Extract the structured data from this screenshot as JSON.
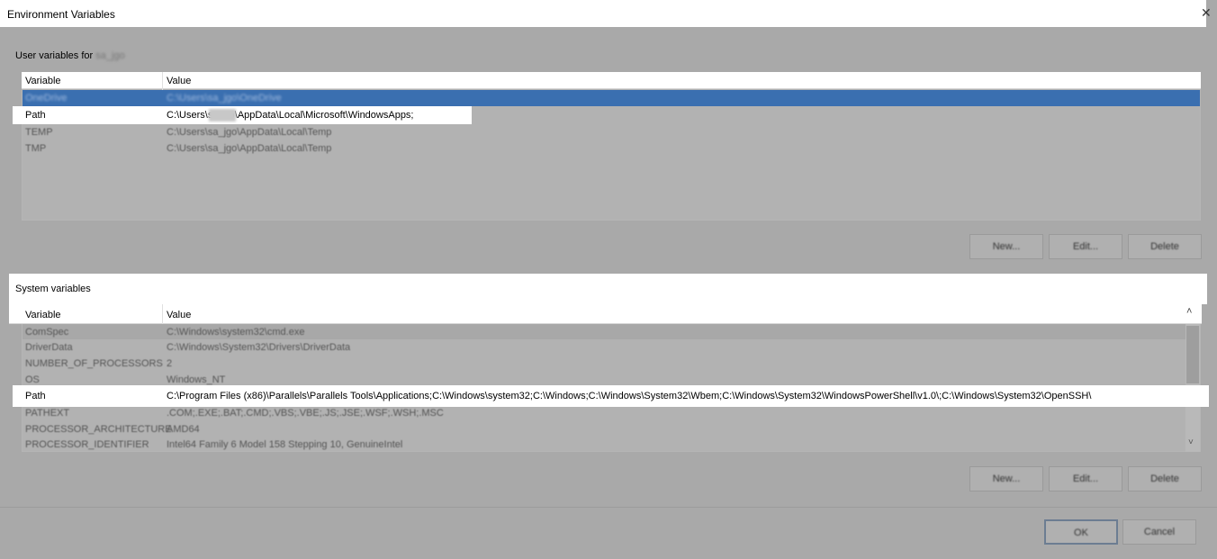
{
  "window": {
    "title": "Environment Variables",
    "close_glyph": "✕"
  },
  "user_vars": {
    "group_label": "User variables for",
    "user_name": "sa_jgo",
    "columns": [
      "Variable",
      "Value"
    ],
    "rows": [
      {
        "name": "OneDrive",
        "value": "C:\\Users\\sa_jgo\\OneDrive"
      },
      {
        "name": "Path",
        "value": "C:\\Users\\s      o\\AppData\\Local\\Microsoft\\WindowsApps;"
      },
      {
        "name": "TEMP",
        "value": "C:\\Users\\sa_jgo\\AppData\\Local\\Temp"
      },
      {
        "name": "TMP",
        "value": "C:\\Users\\sa_jgo\\AppData\\Local\\Temp"
      }
    ],
    "buttons": {
      "new": "New...",
      "edit": "Edit...",
      "delete": "Delete"
    }
  },
  "system_vars": {
    "group_label": "System variables",
    "columns": [
      "Variable",
      "Value"
    ],
    "rows": [
      {
        "name": "ComSpec",
        "value": "C:\\Windows\\system32\\cmd.exe"
      },
      {
        "name": "DriverData",
        "value": "C:\\Windows\\System32\\Drivers\\DriverData"
      },
      {
        "name": "NUMBER_OF_PROCESSORS",
        "value": "2"
      },
      {
        "name": "OS",
        "value": "Windows_NT"
      },
      {
        "name": "Path",
        "value": "C:\\Program Files (x86)\\Parallels\\Parallels Tools\\Applications;C:\\Windows\\system32;C:\\Windows;C:\\Windows\\System32\\Wbem;C:\\Windows\\System32\\WindowsPowerShell\\v1.0\\;C:\\Windows\\System32\\OpenSSH\\"
      },
      {
        "name": "PATHEXT",
        "value": ".COM;.EXE;.BAT;.CMD;.VBS;.VBE;.JS;.JSE;.WSF;.WSH;.MSC"
      },
      {
        "name": "PROCESSOR_ARCHITECTURE",
        "value": "AMD64"
      },
      {
        "name": "PROCESSOR_IDENTIFIER",
        "value": "Intel64 Family 6 Model 158 Stepping 10, GenuineIntel"
      }
    ],
    "buttons": {
      "new": "New...",
      "edit": "Edit...",
      "delete": "Delete"
    }
  },
  "dialog_buttons": {
    "ok": "OK",
    "cancel": "Cancel"
  },
  "scroll": {
    "up_glyph": "˄",
    "down_glyph": "˅"
  },
  "colors": {
    "selection": "#3a6fb0",
    "overlay": "#a9a9a9",
    "highlight": "#ffffff"
  }
}
